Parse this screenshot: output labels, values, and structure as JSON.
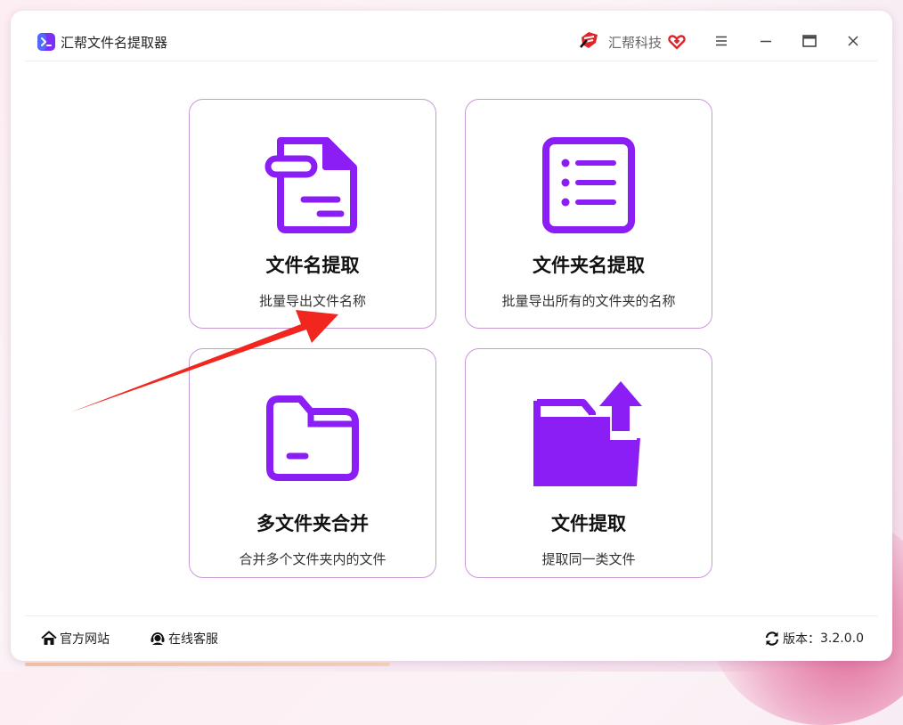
{
  "window": {
    "app_title": "汇帮文件名提取器",
    "brand_name": "汇帮科技"
  },
  "theme": {
    "accent": "#8a1ef5",
    "card_border": "#c99ad6",
    "annotation_arrow": "#f0261f"
  },
  "cards": [
    {
      "title": "文件名提取",
      "desc": "批量导出文件名称",
      "icon": "file-document-icon"
    },
    {
      "title": "文件夹名提取",
      "desc": "批量导出所有的文件夹的名称",
      "icon": "list-document-icon"
    },
    {
      "title": "多文件夹合并",
      "desc": "合并多个文件夹内的文件",
      "icon": "folder-icon"
    },
    {
      "title": "文件提取",
      "desc": "提取同一类文件",
      "icon": "folder-upload-icon"
    }
  ],
  "footer": {
    "site_label": "官方网站",
    "service_label": "在线客服",
    "version_label": "版本：",
    "version_value": "3.2.0.0"
  }
}
